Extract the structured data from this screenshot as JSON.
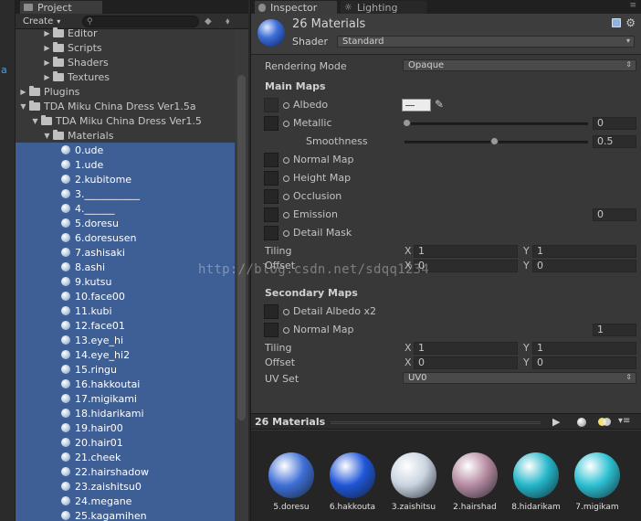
{
  "left_strip": {
    "letter": "a"
  },
  "project": {
    "tab_label": "Project",
    "create_label": "Create",
    "search_placeholder": "",
    "tree": [
      {
        "label": "Editor",
        "indent": 2,
        "type": "folder",
        "expanded": false
      },
      {
        "label": "Scripts",
        "indent": 2,
        "type": "folder",
        "expanded": false
      },
      {
        "label": "Shaders",
        "indent": 2,
        "type": "folder",
        "expanded": false
      },
      {
        "label": "Textures",
        "indent": 2,
        "type": "folder",
        "expanded": false
      },
      {
        "label": "Plugins",
        "indent": 0,
        "type": "folder",
        "expanded": false
      },
      {
        "label": "TDA Miku China Dress Ver1.5a",
        "indent": 0,
        "type": "folder",
        "expanded": true
      },
      {
        "label": "TDA Miku China Dress Ver1.5",
        "indent": 1,
        "type": "folder",
        "expanded": true
      },
      {
        "label": "Materials",
        "indent": 2,
        "type": "folder",
        "expanded": true
      },
      {
        "label": "0.ude",
        "indent": 3,
        "type": "material",
        "selected": true
      },
      {
        "label": "1.ude",
        "indent": 3,
        "type": "material",
        "selected": true
      },
      {
        "label": "2.kubitome",
        "indent": 3,
        "type": "material",
        "selected": true
      },
      {
        "label": "3.___________",
        "indent": 3,
        "type": "material",
        "selected": true
      },
      {
        "label": "4.______",
        "indent": 3,
        "type": "material",
        "selected": true
      },
      {
        "label": "5.doresu",
        "indent": 3,
        "type": "material",
        "selected": true
      },
      {
        "label": "6.doresusen",
        "indent": 3,
        "type": "material",
        "selected": true
      },
      {
        "label": "7.ashisaki",
        "indent": 3,
        "type": "material",
        "selected": true
      },
      {
        "label": "8.ashi",
        "indent": 3,
        "type": "material",
        "selected": true
      },
      {
        "label": "9.kutsu",
        "indent": 3,
        "type": "material",
        "selected": true
      },
      {
        "label": "10.face00",
        "indent": 3,
        "type": "material",
        "selected": true
      },
      {
        "label": "11.kubi",
        "indent": 3,
        "type": "material",
        "selected": true
      },
      {
        "label": "12.face01",
        "indent": 3,
        "type": "material",
        "selected": true
      },
      {
        "label": "13.eye_hi",
        "indent": 3,
        "type": "material",
        "selected": true
      },
      {
        "label": "14.eye_hi2",
        "indent": 3,
        "type": "material",
        "selected": true
      },
      {
        "label": "15.ringu",
        "indent": 3,
        "type": "material",
        "selected": true
      },
      {
        "label": "16.hakkoutai",
        "indent": 3,
        "type": "material",
        "selected": true
      },
      {
        "label": "17.migikami",
        "indent": 3,
        "type": "material",
        "selected": true
      },
      {
        "label": "18.hidarikami",
        "indent": 3,
        "type": "material",
        "selected": true
      },
      {
        "label": "19.hair00",
        "indent": 3,
        "type": "material",
        "selected": true
      },
      {
        "label": "20.hair01",
        "indent": 3,
        "type": "material",
        "selected": true
      },
      {
        "label": "21.cheek",
        "indent": 3,
        "type": "material",
        "selected": true
      },
      {
        "label": "22.hairshadow",
        "indent": 3,
        "type": "material",
        "selected": true
      },
      {
        "label": "23.zaishitsu0",
        "indent": 3,
        "type": "material",
        "selected": true
      },
      {
        "label": "24.megane",
        "indent": 3,
        "type": "material",
        "selected": true
      },
      {
        "label": "25.kagamihen",
        "indent": 3,
        "type": "material",
        "selected": true
      }
    ]
  },
  "inspector": {
    "tab_label": "Inspector",
    "lighting_tab_label": "Lighting",
    "title": "26 Materials",
    "shader_label": "Shader",
    "shader_value": "Standard",
    "rendering_mode_label": "Rendering Mode",
    "rendering_mode_value": "Opaque",
    "main_maps_label": "Main Maps",
    "albedo_label": "Albedo",
    "metallic_label": "Metallic",
    "metallic_value": "0",
    "metallic_slider": 0.0,
    "smoothness_label": "Smoothness",
    "smoothness_value": "0.5",
    "smoothness_slider": 0.5,
    "normal_map_label": "Normal Map",
    "height_map_label": "Height Map",
    "occlusion_label": "Occlusion",
    "emission_label": "Emission",
    "emission_value": "0",
    "detail_mask_label": "Detail Mask",
    "tiling_label": "Tiling",
    "offset_label": "Offset",
    "x_label": "X",
    "y_label": "Y",
    "main_tiling_x": "1",
    "main_tiling_y": "1",
    "main_offset_x": "0",
    "main_offset_y": "0",
    "secondary_maps_label": "Secondary Maps",
    "detail_albedo_label": "Detail Albedo x2",
    "sec_normal_map_label": "Normal Map",
    "sec_normal_value": "1",
    "sec_tiling_x": "1",
    "sec_tiling_y": "1",
    "sec_offset_x": "0",
    "sec_offset_y": "0",
    "uv_set_label": "UV Set",
    "uv_set_value": "UV0"
  },
  "preview": {
    "title": "26 Materials",
    "thumbnails": [
      {
        "name": "5.doresu",
        "color": "#3f6fd6"
      },
      {
        "name": "6.hakkouta",
        "color": "#1f56d8"
      },
      {
        "name": "3.zaishitsu",
        "color": "#c9d3df"
      },
      {
        "name": "2.hairshad",
        "color": "#b58aa0"
      },
      {
        "name": "8.hidarikam",
        "color": "#23b6c9"
      },
      {
        "name": "7.migikam",
        "color": "#2cc0d2"
      }
    ]
  },
  "watermark": "http://blog.csdn.net/sdqq1234"
}
